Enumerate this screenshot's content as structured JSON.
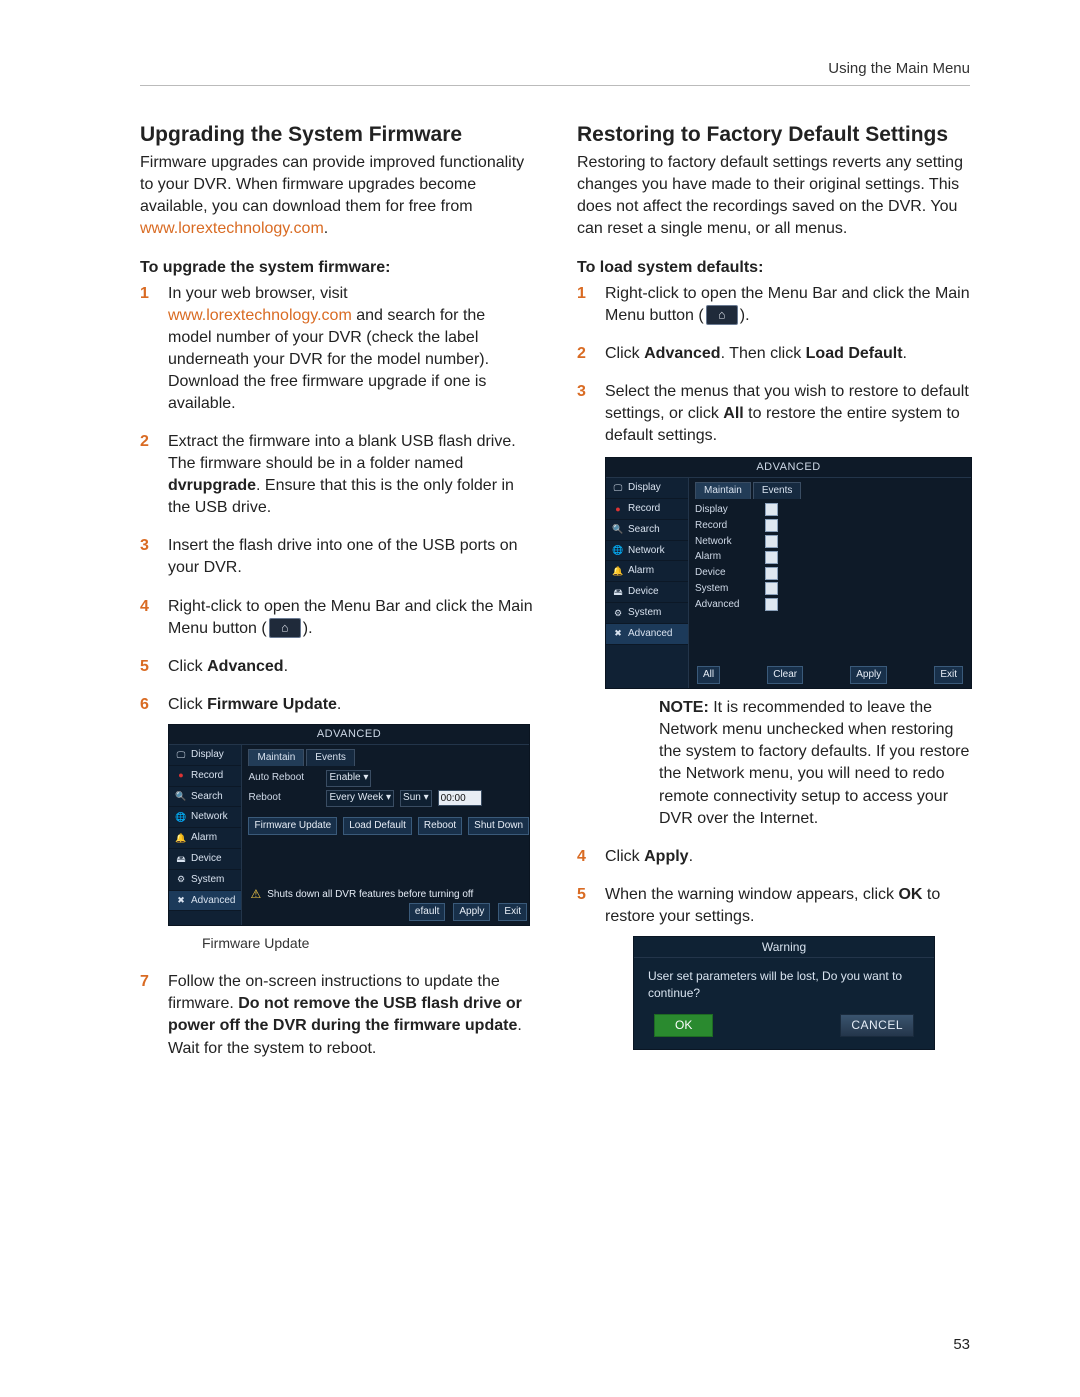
{
  "page": {
    "running_head": "Using the Main Menu",
    "number": "53"
  },
  "link_url": "www.lorextechnology.com",
  "left": {
    "heading": "Upgrading the System Firmware",
    "intro_pre": "Firmware upgrades can provide improved functionality to your DVR. When firmware upgrades become available, you can download them for free from ",
    "intro_post": ".",
    "subhead": "To upgrade the system firmware:",
    "step1_pre": "In your web browser, visit ",
    "step1_post": " and search for the model number of your DVR (check the label underneath your DVR for the model number). Download the free firmware upgrade if one is available.",
    "step2_a": "Extract the firmware into a blank USB flash drive. The firmware should be in a folder named ",
    "step2_bold": "dvrupgrade",
    "step2_b": ". Ensure that this is the only folder in the USB drive.",
    "step3": "Insert the flash drive into one of the USB ports on your DVR.",
    "step4_a": "Right-click to open the Menu Bar and click the Main Menu button (",
    "step4_b": ").",
    "step5_a": "Click ",
    "step5_bold": "Advanced",
    "step5_b": ".",
    "step6_a": "Click ",
    "step6_bold": "Firmware Update",
    "step6_b": ".",
    "caption": "Firmware Update",
    "step7_a": "Follow the on-screen instructions to update the firmware. ",
    "step7_bold": "Do not remove the USB flash drive or power off the DVR during the firmware update",
    "step7_b": ". Wait for the system to reboot."
  },
  "right": {
    "heading": "Restoring to Factory Default Settings",
    "intro": "Restoring to factory default settings reverts any setting changes you have made to their original settings. This does not affect the recordings saved on the DVR. You can reset a single menu, or all menus.",
    "subhead": "To load system defaults:",
    "step1_a": "Right-click to open the Menu Bar and click the Main Menu button (",
    "step1_b": ").",
    "step2_a": "Click ",
    "step2_bold1": "Advanced",
    "step2_mid": ". Then click ",
    "step2_bold2": "Load Default",
    "step2_b": ".",
    "step3_a": "Select the menus that you wish to restore to default settings, or click ",
    "step3_bold": "All",
    "step3_b": " to restore the entire system to default settings.",
    "note_label": "NOTE:",
    "note_text": " It is recommended to leave the Network menu unchecked when restoring the system to factory defaults. If you restore the Network menu, you will need to redo remote connectivity setup to access your DVR over the Internet.",
    "step4_a": "Click ",
    "step4_bold": "Apply",
    "step4_b": ".",
    "step5_a": "When the warning window appears, click ",
    "step5_bold": "OK",
    "step5_b": " to restore your settings."
  },
  "panel": {
    "title": "ADVANCED",
    "nav": [
      "Display",
      "Record",
      "Search",
      "Network",
      "Alarm",
      "Device",
      "System",
      "Advanced"
    ],
    "tabs": [
      "Maintain",
      "Events"
    ],
    "row_auto_reboot_label": "Auto Reboot",
    "row_auto_reboot_value": "Enable",
    "row_reboot_label": "Reboot",
    "row_reboot_every": "Every Week",
    "row_reboot_day": "Sun",
    "row_reboot_time": "00:00",
    "btn_fw": "Firmware Update",
    "btn_ld": "Load Default",
    "btn_rb": "Reboot",
    "btn_sd": "Shut Down",
    "warn_text": "Shuts down all DVR features before turning off",
    "btn_default": "efault",
    "btn_apply": "Apply",
    "btn_exit": "Exit"
  },
  "defaults_panel": {
    "items": [
      "Display",
      "Record",
      "Network",
      "Alarm",
      "Device",
      "System",
      "Advanced"
    ],
    "btn_all": "All",
    "btn_clear": "Clear",
    "btn_apply": "Apply",
    "btn_exit": "Exit"
  },
  "warning_dialog": {
    "title": "Warning",
    "body": "User set parameters will be lost, Do you want to continue?",
    "ok": "OK",
    "cancel": "CANCEL"
  }
}
